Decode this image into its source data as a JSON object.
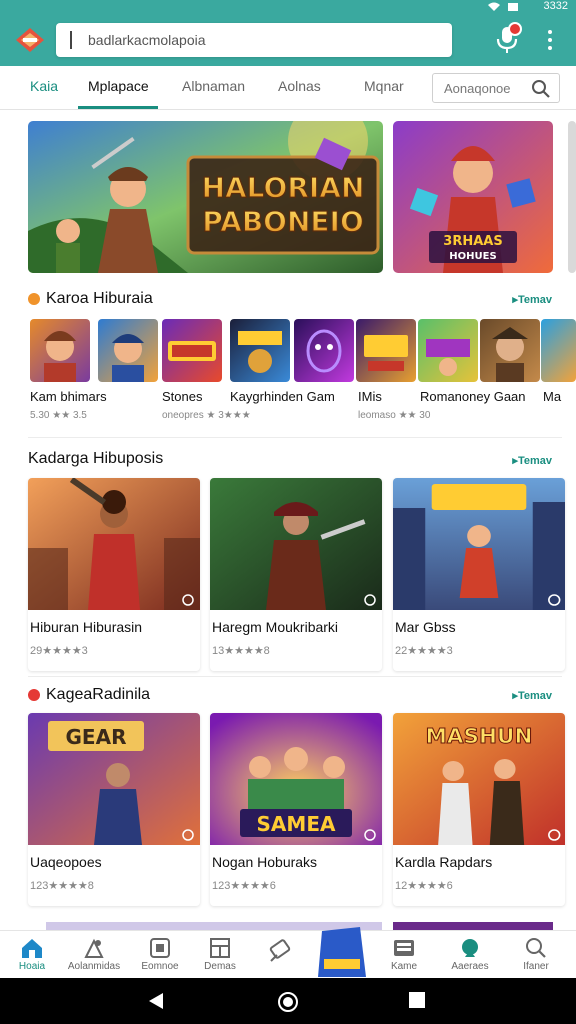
{
  "status": {
    "time": "3332"
  },
  "header": {
    "search_text": "badlarkacmolapoia",
    "colors": {
      "primary": "#3aa99f",
      "accent": "#1a8e80",
      "badge": "#e53935"
    },
    "icons": [
      "logo-icon",
      "mic-icon",
      "more-vert-icon"
    ]
  },
  "tabs": {
    "items": [
      "Kaia",
      "Mplapace",
      "Albnaman",
      "Aolnas",
      "Mqnar"
    ],
    "active": "Mplapace",
    "search_placeholder": "Aonaqonoe"
  },
  "banners": [
    {
      "title_line1": "HALORIAN",
      "title_line2": "PABONEIO"
    },
    {
      "title_line1": "3RHAAS",
      "title_line2": "HOHUES"
    }
  ],
  "section1": {
    "title": "Karoa Hiburaia",
    "see_all": "Temav",
    "apps": [
      {
        "name": "Kam bhimars",
        "meta": "5.30 ★★ 3.5"
      },
      {
        "name": "Stones",
        "meta": "oneopres ★ 3★★★"
      },
      {
        "name": "Kaygrhinden Gam",
        "meta": ""
      },
      {
        "name": "IMis",
        "meta": "leomaso ★★ 30"
      },
      {
        "name": "Romanoney Gaan",
        "meta": ""
      },
      {
        "name": "Ma",
        "meta": ""
      }
    ]
  },
  "section2": {
    "title": "Kadarga Hibuposis",
    "see_all": "Temav",
    "cards": [
      {
        "title": "Hiburan Hiburasin",
        "meta": "29★★★★3"
      },
      {
        "title": "Haregm Moukribarki",
        "meta": "13★★★★8"
      },
      {
        "title": "Mar Gbss",
        "meta": "22★★★★3"
      }
    ]
  },
  "section3": {
    "title": "KageaRadinila",
    "see_all": "Temav",
    "cards": [
      {
        "title": "Uaqeopoes",
        "meta": "123★★★★8",
        "art_text": "GEAR"
      },
      {
        "title": "Nogan Hoburaks",
        "meta": "123★★★★6",
        "art_text": "SAMEA"
      },
      {
        "title": "Kardla Rapdars",
        "meta": "12★★★★6",
        "art_text": "MASHUN"
      }
    ]
  },
  "bottom_nav": {
    "items": [
      {
        "label": "Hoaia",
        "icon": "home-icon"
      },
      {
        "label": "Aolanmidas",
        "icon": "games-icon"
      },
      {
        "label": "Eomnoe",
        "icon": "apps-icon"
      },
      {
        "label": "Demas",
        "icon": "grid-icon"
      },
      {
        "label": "",
        "icon": "ticket-icon"
      },
      {
        "label": "",
        "icon": "featured-icon"
      },
      {
        "label": "Kame",
        "icon": "library-icon"
      },
      {
        "label": "Aaeraes",
        "icon": "market-icon"
      },
      {
        "label": "Ifaner",
        "icon": "search-icon"
      }
    ],
    "active": "Hoaia"
  },
  "system_bar": {
    "icons": [
      "back-icon",
      "home-circle-icon",
      "recents-icon"
    ]
  }
}
